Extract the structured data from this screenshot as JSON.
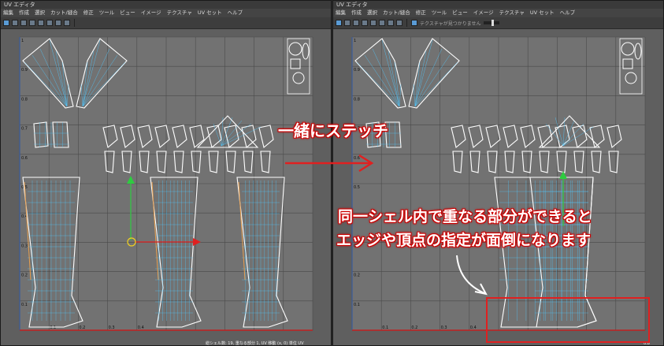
{
  "left_panel": {
    "title": "UV エディタ",
    "menu": [
      "編集",
      "作成",
      "選択",
      "カット/縫合",
      "修正",
      "ツール",
      "ビュー",
      "イメージ",
      "テクスチャ",
      "UV セット",
      "ヘルプ"
    ]
  },
  "right_panel": {
    "title": "UV エディタ",
    "menu": [
      "編集",
      "作成",
      "選択",
      "カット/縫合",
      "修正",
      "ツール",
      "ビュー",
      "イメージ",
      "テクスチャ",
      "UV セット",
      "ヘルプ"
    ],
    "texture_label": "テクスチャが見つかりません"
  },
  "grid": {
    "y_ticks": [
      "1",
      "0.9",
      "0.8",
      "0.7",
      "0.6",
      "0.5",
      "0.4",
      "0.3",
      "0.2",
      "0.1"
    ],
    "x_ticks": [
      "0.1",
      "0.2",
      "0.3",
      "0.4"
    ],
    "status_left": "総シェル数: 19, 重なる部分 1, UV 移動 (x, 0) 単位 UV",
    "status_right": "0.8"
  },
  "annotations": {
    "stitch_together": "一緒にステッチ",
    "overlap_line1": "同一シェル内で重なる部分ができると",
    "overlap_line2": "エッジや頂点の指定が面倒になります"
  },
  "colors": {
    "accent_red": "#e02020",
    "uv_white": "#ffffff",
    "uv_wire": "#4fc8ff",
    "orange_edge": "#e8a050"
  }
}
